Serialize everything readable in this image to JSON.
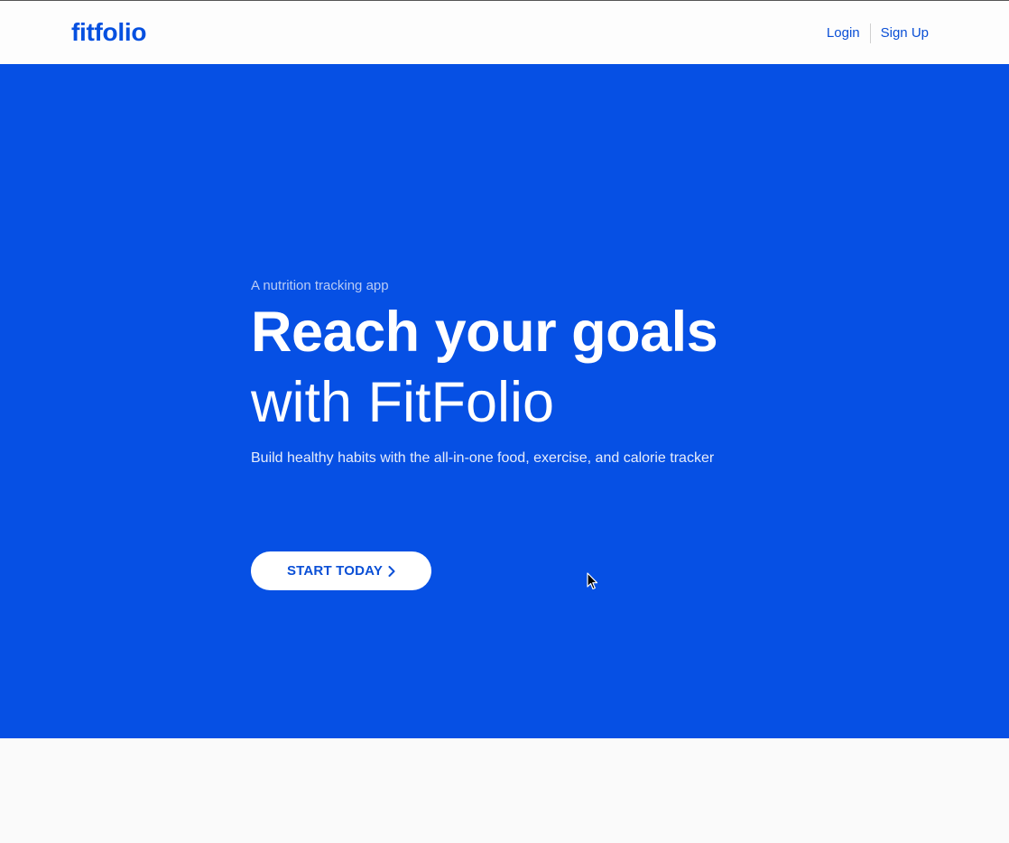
{
  "navbar": {
    "logo": "fitfolio",
    "login_label": "Login",
    "signup_label": "Sign Up"
  },
  "hero": {
    "eyebrow": "A nutrition tracking app",
    "headline_line1": "Reach your goals",
    "headline_line2": "with FitFolio",
    "subhead": "Build healthy habits with the all-in-one food, exercise, and calorie tracker",
    "cta_label": "START TODAY",
    "cta_icon": "chevron-right-icon"
  },
  "colors": {
    "brand": "#0650e4",
    "logo": "#0650e0",
    "link": "#0a4fd6",
    "hero_text": "#ffffff",
    "eyebrow_text": "#b9cbf5",
    "page_background": "#fafafa"
  }
}
